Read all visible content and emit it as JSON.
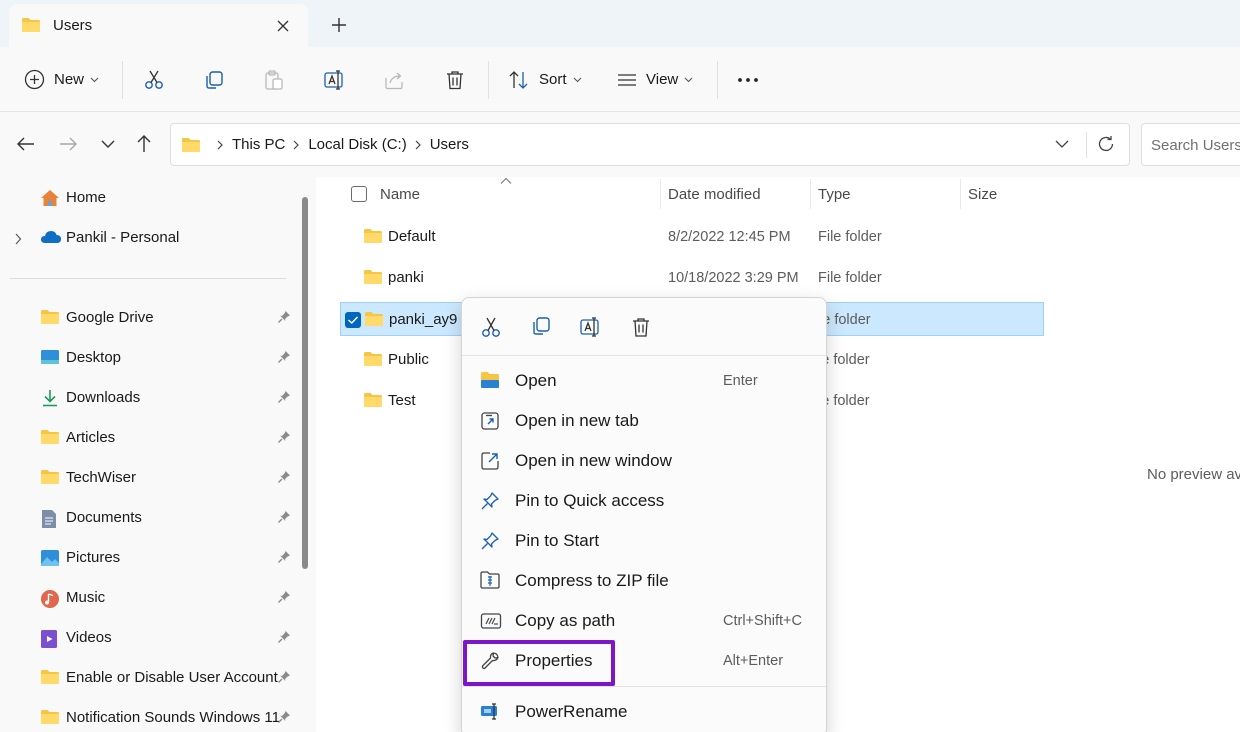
{
  "window": {
    "tab_title": "Users",
    "tab_icon": "folder-icon",
    "new_tab_symbol": "+"
  },
  "toolbar": {
    "new_label": "New",
    "sort_label": "Sort",
    "view_label": "View",
    "icons": [
      "cut-icon",
      "copy-icon",
      "paste-icon",
      "rename-icon",
      "share-icon",
      "delete-icon",
      "more-icon"
    ]
  },
  "address": {
    "crumbs": [
      "This PC",
      "Local Disk (C:)",
      "Users"
    ],
    "search_placeholder": "Search Users"
  },
  "sidebar": {
    "top_items": [
      {
        "label": "Home",
        "icon": "home-icon"
      },
      {
        "label": "Pankil - Personal",
        "icon": "onedrive-cloud-icon"
      }
    ],
    "pinned_items": [
      {
        "label": "Google Drive",
        "icon": "folder-icon"
      },
      {
        "label": "Desktop",
        "icon": "desktop-icon"
      },
      {
        "label": "Downloads",
        "icon": "download-icon"
      },
      {
        "label": "Articles",
        "icon": "folder-icon"
      },
      {
        "label": "TechWiser",
        "icon": "folder-icon"
      },
      {
        "label": "Documents",
        "icon": "documents-icon"
      },
      {
        "label": "Pictures",
        "icon": "pictures-icon"
      },
      {
        "label": "Music",
        "icon": "music-icon"
      },
      {
        "label": "Videos",
        "icon": "videos-icon"
      },
      {
        "label": "Enable or Disable User Account",
        "icon": "folder-icon"
      },
      {
        "label": "Notification Sounds Windows 11",
        "icon": "folder-icon"
      }
    ]
  },
  "files": {
    "columns": [
      "Name",
      "Date modified",
      "Type",
      "Size"
    ],
    "rows": [
      {
        "name": "Default",
        "date": "8/2/2022 12:45 PM",
        "type": "File folder"
      },
      {
        "name": "panki",
        "date": "10/18/2022 3:29 PM",
        "type": "File folder"
      },
      {
        "name": "panki_ay9",
        "date": "",
        "type": "le folder",
        "selected": true
      },
      {
        "name": "Public",
        "date": "",
        "type": "le folder"
      },
      {
        "name": "Test",
        "date": "",
        "type": "le folder"
      }
    ]
  },
  "preview": {
    "text": "No preview av"
  },
  "context_menu": {
    "quick_actions": [
      "cut-icon",
      "copy-icon",
      "rename-icon",
      "delete-icon"
    ],
    "items": [
      {
        "label": "Open",
        "shortcut": "Enter",
        "icon": "folder-open-icon"
      },
      {
        "label": "Open in new tab",
        "shortcut": "",
        "icon": "open-new-tab-icon"
      },
      {
        "label": "Open in new window",
        "shortcut": "",
        "icon": "open-new-window-icon"
      },
      {
        "label": "Pin to Quick access",
        "shortcut": "",
        "icon": "pin-icon"
      },
      {
        "label": "Pin to Start",
        "shortcut": "",
        "icon": "pin-icon"
      },
      {
        "label": "Compress to ZIP file",
        "shortcut": "",
        "icon": "zip-icon"
      },
      {
        "label": "Copy as path",
        "shortcut": "Ctrl+Shift+C",
        "icon": "copy-path-icon"
      },
      {
        "label": "Properties",
        "shortcut": "Alt+Enter",
        "icon": "wrench-icon",
        "highlighted": true
      },
      {
        "label": "PowerRename",
        "shortcut": "",
        "icon": "powerrename-icon"
      }
    ]
  },
  "colors": {
    "accent": "#0067c0",
    "selection": "#cce8ff",
    "highlight_box": "#7b16c9",
    "folder": "#f6c544"
  }
}
